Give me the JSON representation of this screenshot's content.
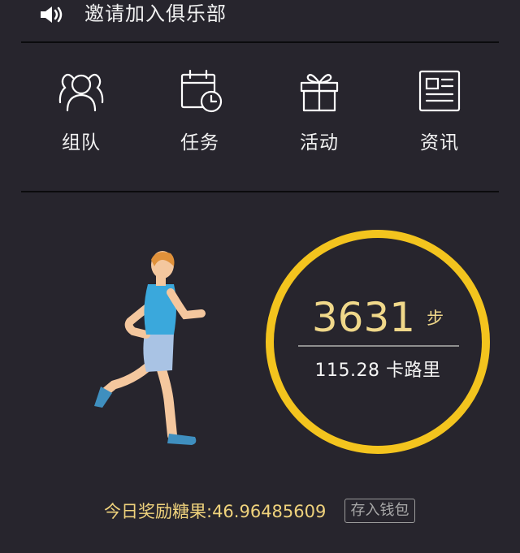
{
  "header": {
    "invite_text": "邀请加入俱乐部"
  },
  "nav": {
    "items": [
      {
        "label": "组队",
        "icon": "team-icon"
      },
      {
        "label": "任务",
        "icon": "calendar-clock-icon"
      },
      {
        "label": "活动",
        "icon": "gift-icon"
      },
      {
        "label": "资讯",
        "icon": "news-icon"
      }
    ]
  },
  "stats": {
    "steps": "3631",
    "steps_unit": "步",
    "calories": "115.28 卡路里"
  },
  "reward": {
    "text": "今日奖励糖果:46.96485609",
    "button_label": "存入钱包"
  },
  "colors": {
    "background": "#27252d",
    "ring": "#f3c41e",
    "accent_text": "#efd27c"
  }
}
